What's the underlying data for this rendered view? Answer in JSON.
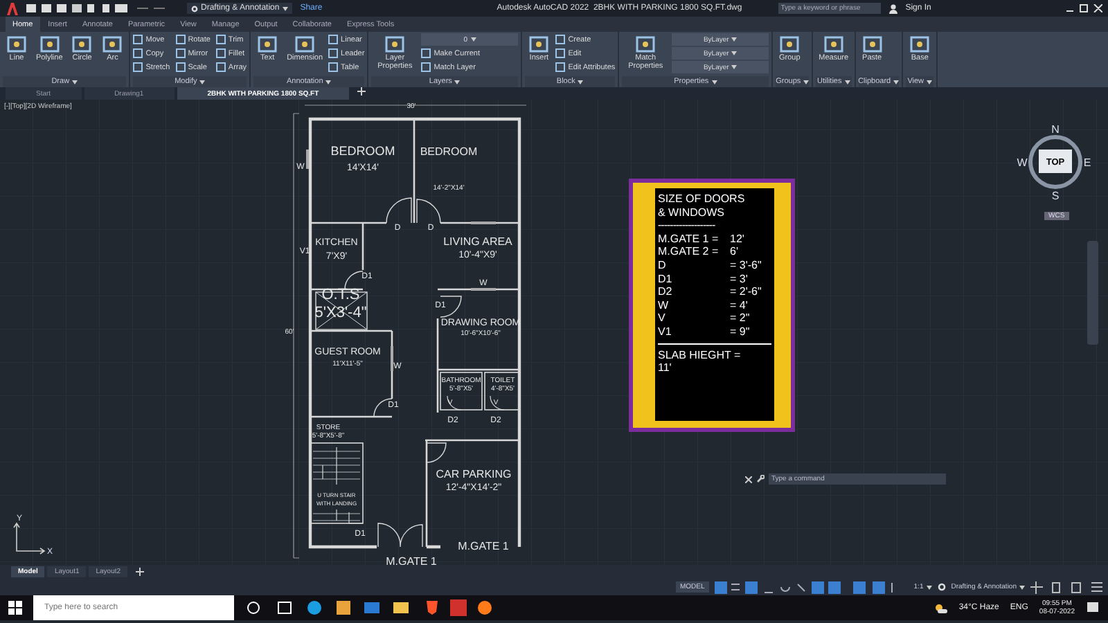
{
  "title_bar": {
    "workspace": "Drafting & Annotation",
    "share": "Share",
    "title": "Autodesk AutoCAD 2022",
    "file": "2BHK WITH PARKING 1800 SQ.FT.dwg",
    "search": {
      "placeholder": "Type a keyword or phrase"
    },
    "sign_in": "Sign In"
  },
  "ribbon_tabs": [
    {
      "label": "Home",
      "selected": true
    },
    {
      "label": "Insert",
      "selected": false
    },
    {
      "label": "Annotate",
      "selected": false
    },
    {
      "label": "Parametric",
      "selected": false
    },
    {
      "label": "View",
      "selected": false
    },
    {
      "label": "Manage",
      "selected": false
    },
    {
      "label": "Output",
      "selected": false
    },
    {
      "label": "Collaborate",
      "selected": false
    },
    {
      "label": "Express Tools",
      "selected": false
    }
  ],
  "ribbon_panels": [
    {
      "title": "Draw",
      "tools": [
        {
          "label": "Line",
          "kind": "large"
        },
        {
          "label": "Polyline",
          "kind": "large"
        },
        {
          "label": "Circle",
          "kind": "large"
        },
        {
          "label": "Arc",
          "kind": "large"
        }
      ]
    },
    {
      "title": "Modify",
      "tools": [
        {
          "label": "Move",
          "kind": "small"
        },
        {
          "label": "Copy",
          "kind": "small"
        },
        {
          "label": "Stretch",
          "kind": "small"
        },
        {
          "label": "Rotate",
          "kind": "small"
        },
        {
          "label": "Mirror",
          "kind": "small"
        },
        {
          "label": "Scale",
          "kind": "small"
        },
        {
          "label": "Trim",
          "kind": "small"
        },
        {
          "label": "Fillet",
          "kind": "small"
        },
        {
          "label": "Array",
          "kind": "small"
        }
      ]
    },
    {
      "title": "Annotation",
      "tools": [
        {
          "label": "Text",
          "kind": "large"
        },
        {
          "label": "Dimension",
          "kind": "large"
        },
        {
          "label": "Linear",
          "kind": "small"
        },
        {
          "label": "Leader",
          "kind": "small"
        },
        {
          "label": "Table",
          "kind": "small"
        }
      ]
    },
    {
      "title": "Layers",
      "tools": [
        {
          "label": "Layer Properties",
          "kind": "large"
        },
        {
          "label": "0",
          "kind": "dropdown"
        },
        {
          "label": "Make Current",
          "kind": "small"
        },
        {
          "label": "Match Layer",
          "kind": "small"
        }
      ]
    },
    {
      "title": "Block",
      "tools": [
        {
          "label": "Insert",
          "kind": "large"
        },
        {
          "label": "Create",
          "kind": "small"
        },
        {
          "label": "Edit",
          "kind": "small"
        },
        {
          "label": "Edit Attributes",
          "kind": "small"
        }
      ]
    },
    {
      "title": "Properties",
      "tools": [
        {
          "label": "Match Properties",
          "kind": "large"
        },
        {
          "label": "ByLayer",
          "kind": "dropdown"
        },
        {
          "label": "ByLayer",
          "kind": "dropdown"
        },
        {
          "label": "ByLayer",
          "kind": "dropdown"
        }
      ]
    },
    {
      "title": "Groups",
      "tools": [
        {
          "label": "Group",
          "kind": "large"
        }
      ]
    },
    {
      "title": "Utilities",
      "tools": [
        {
          "label": "Measure",
          "kind": "large"
        }
      ]
    },
    {
      "title": "Clipboard",
      "tools": [
        {
          "label": "Paste",
          "kind": "large"
        }
      ]
    },
    {
      "title": "View",
      "tools": [
        {
          "label": "Base",
          "kind": "large"
        }
      ]
    }
  ],
  "file_tabs": [
    {
      "label": "Start",
      "selected": false
    },
    {
      "label": "Drawing1",
      "selected": false
    },
    {
      "label": "2BHK WITH PARKING 1800 SQ.FT",
      "selected": true
    }
  ],
  "viewport_label": "[-][Top][2D Wireframe]",
  "rooms": [
    {
      "name": "BEDROOM",
      "size": "14'X14'"
    },
    {
      "name": "BEDROOM",
      "size": "14'-2\"X14'"
    },
    {
      "name": "KITCHEN",
      "size": "7'X9'"
    },
    {
      "name": "LIVING AREA",
      "size": "10'-4\"X9'"
    },
    {
      "name": "O.T.S",
      "size": "5'X3'-4\""
    },
    {
      "name": "DRAWING ROOM",
      "size": "10'-6\"X10'-6\""
    },
    {
      "name": "GUEST ROOM",
      "size": "11'X11'-5\""
    },
    {
      "name": "BATHROOM",
      "size": "5'-8\"X5'"
    },
    {
      "name": "TOILET",
      "size": "4'-8\"X5'"
    },
    {
      "name": "STORE",
      "size": "5'-8\"X5'-8\""
    },
    {
      "name": "U TURN STAIR",
      "size": "WITH LANDING"
    },
    {
      "name": "CAR PARKING",
      "size": "12'-4\"X14'-2\""
    }
  ],
  "plan_tags": [
    "30'",
    "60'",
    "W",
    "V1",
    "D",
    "D",
    "D1",
    "W",
    "D1",
    "W",
    "D1",
    "V",
    "V",
    "D2",
    "D2",
    "D1",
    "M.GATE 1",
    "M.GATE 1"
  ],
  "legend": {
    "heading": [
      "SIZE OF DOORS",
      "& WINDOWS"
    ],
    "rule": "-------------------",
    "rows": [
      {
        "name": "M.GATE 1 =",
        "size": "12'"
      },
      {
        "name": "M.GATE 2 =",
        "size": "6'"
      },
      {
        "name": "D",
        "size": "=   3'-6\""
      },
      {
        "name": "D1",
        "size": "=   3'"
      },
      {
        "name": "D2",
        "size": "=   2'-6\""
      },
      {
        "name": "W",
        "size": "=   4'"
      },
      {
        "name": "V",
        "size": "=   2\""
      },
      {
        "name": "V1",
        "size": "=   9\""
      }
    ],
    "footer": [
      "SLAB HIEGHT =",
      "11'"
    ]
  },
  "view_cube": {
    "top": "TOP",
    "north": "N",
    "south": "S",
    "east": "E",
    "west": "W",
    "wcs": "WCS"
  },
  "command_line": {
    "placeholder": "Type a command"
  },
  "ucs": {
    "x": "X",
    "y": "Y"
  },
  "layout_tabs": [
    {
      "label": "Model",
      "selected": true
    },
    {
      "label": "Layout1",
      "selected": false
    },
    {
      "label": "Layout2",
      "selected": false
    }
  ],
  "status_bar": {
    "mode": "MODEL",
    "scale": "1:1",
    "workspace": "Drafting & Annotation"
  },
  "taskbar": {
    "search": {
      "placeholder": "Type here to search"
    },
    "weather": "34°C  Haze",
    "language": "ENG",
    "time": "09:55 PM",
    "date": "08-07-2022"
  }
}
